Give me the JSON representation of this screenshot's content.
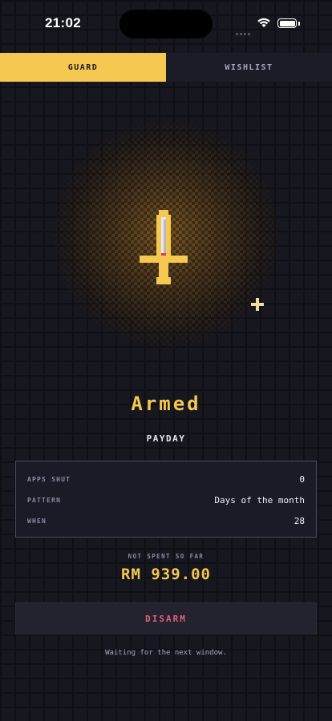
{
  "status_bar": {
    "time": "21:02"
  },
  "tabs": [
    {
      "label": "GUARD",
      "active": true
    },
    {
      "label": "WISHLIST",
      "active": false
    }
  ],
  "guard": {
    "state": "Armed",
    "mode": "PAYDAY",
    "details": [
      {
        "key": "APPS SHUT",
        "value": "0"
      },
      {
        "key": "PATTERN",
        "value": "Days of the month"
      },
      {
        "key": "WHEN",
        "value": "28"
      }
    ],
    "saved_label": "NOT SPENT SO FAR",
    "saved_value": "RM 939.00",
    "action_label": "DISARM",
    "footer": "Waiting for the next window."
  },
  "colors": {
    "accent": "#f5c852",
    "danger": "#e2607a",
    "background": "#17171f",
    "panel": "#1c1c27"
  },
  "icons": {
    "guard_item": "sword-icon",
    "sparkle": "sparkle-icon"
  }
}
